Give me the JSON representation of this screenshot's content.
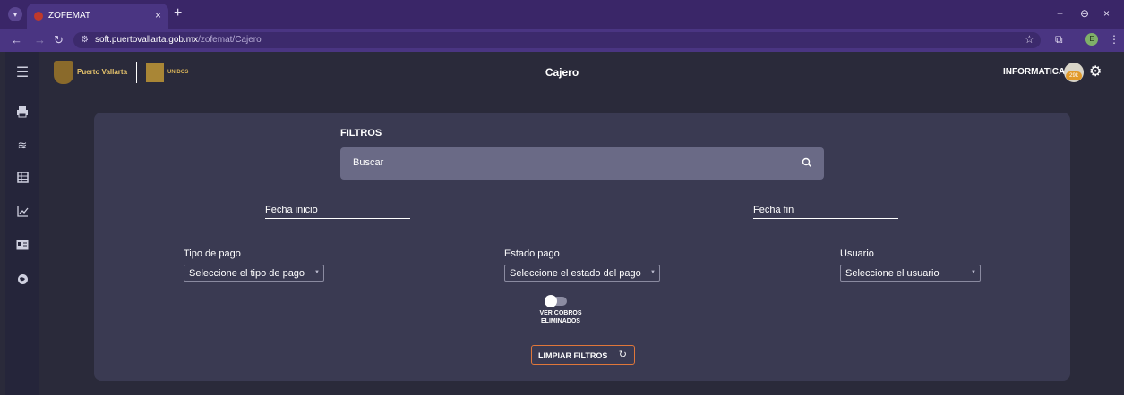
{
  "browser": {
    "tab_title": "ZOFEMAT",
    "tab_close": "×",
    "new_tab": "+",
    "url_domain": "soft.puertovallarta.gob.mx",
    "url_path": "/zofemat/Cajero",
    "profile_initial": "E",
    "window_controls": {
      "minimize": "−",
      "restore": "⊖",
      "close": "×"
    }
  },
  "app": {
    "logo_text": "Puerto Vallarta",
    "logo_text2": "UNIDOS",
    "page_title": "Cajero",
    "user_name": "INFORMATICA",
    "avatar_badge": "29k",
    "sidebar_icons": [
      "menu-icon",
      "printer-icon",
      "layers-icon",
      "table-icon",
      "chart-icon",
      "id-card-icon",
      "globe-icon"
    ]
  },
  "filters": {
    "title": "FILTROS",
    "search_placeholder": "Buscar",
    "fecha_inicio_label": "Fecha inicio",
    "fecha_fin_label": "Fecha fin",
    "tipo_pago_label": "Tipo de pago",
    "tipo_pago_value": "Seleccione el tipo de pago",
    "estado_pago_label": "Estado pago",
    "estado_pago_value": "Seleccione el estado del pago",
    "usuario_label": "Usuario",
    "usuario_value": "Seleccione el usuario",
    "toggle_label_line1": "VER COBROS",
    "toggle_label_line2": "ELIMINADOS",
    "toggle_on": false,
    "clear_button": "LIMPIAR FILTROS"
  },
  "colors": {
    "browser_frame": "#3a2668",
    "app_bg": "#2a2a3a",
    "card_bg": "#3a3a52",
    "search_bg": "#6a6a86",
    "accent_border": "#e0773a"
  }
}
